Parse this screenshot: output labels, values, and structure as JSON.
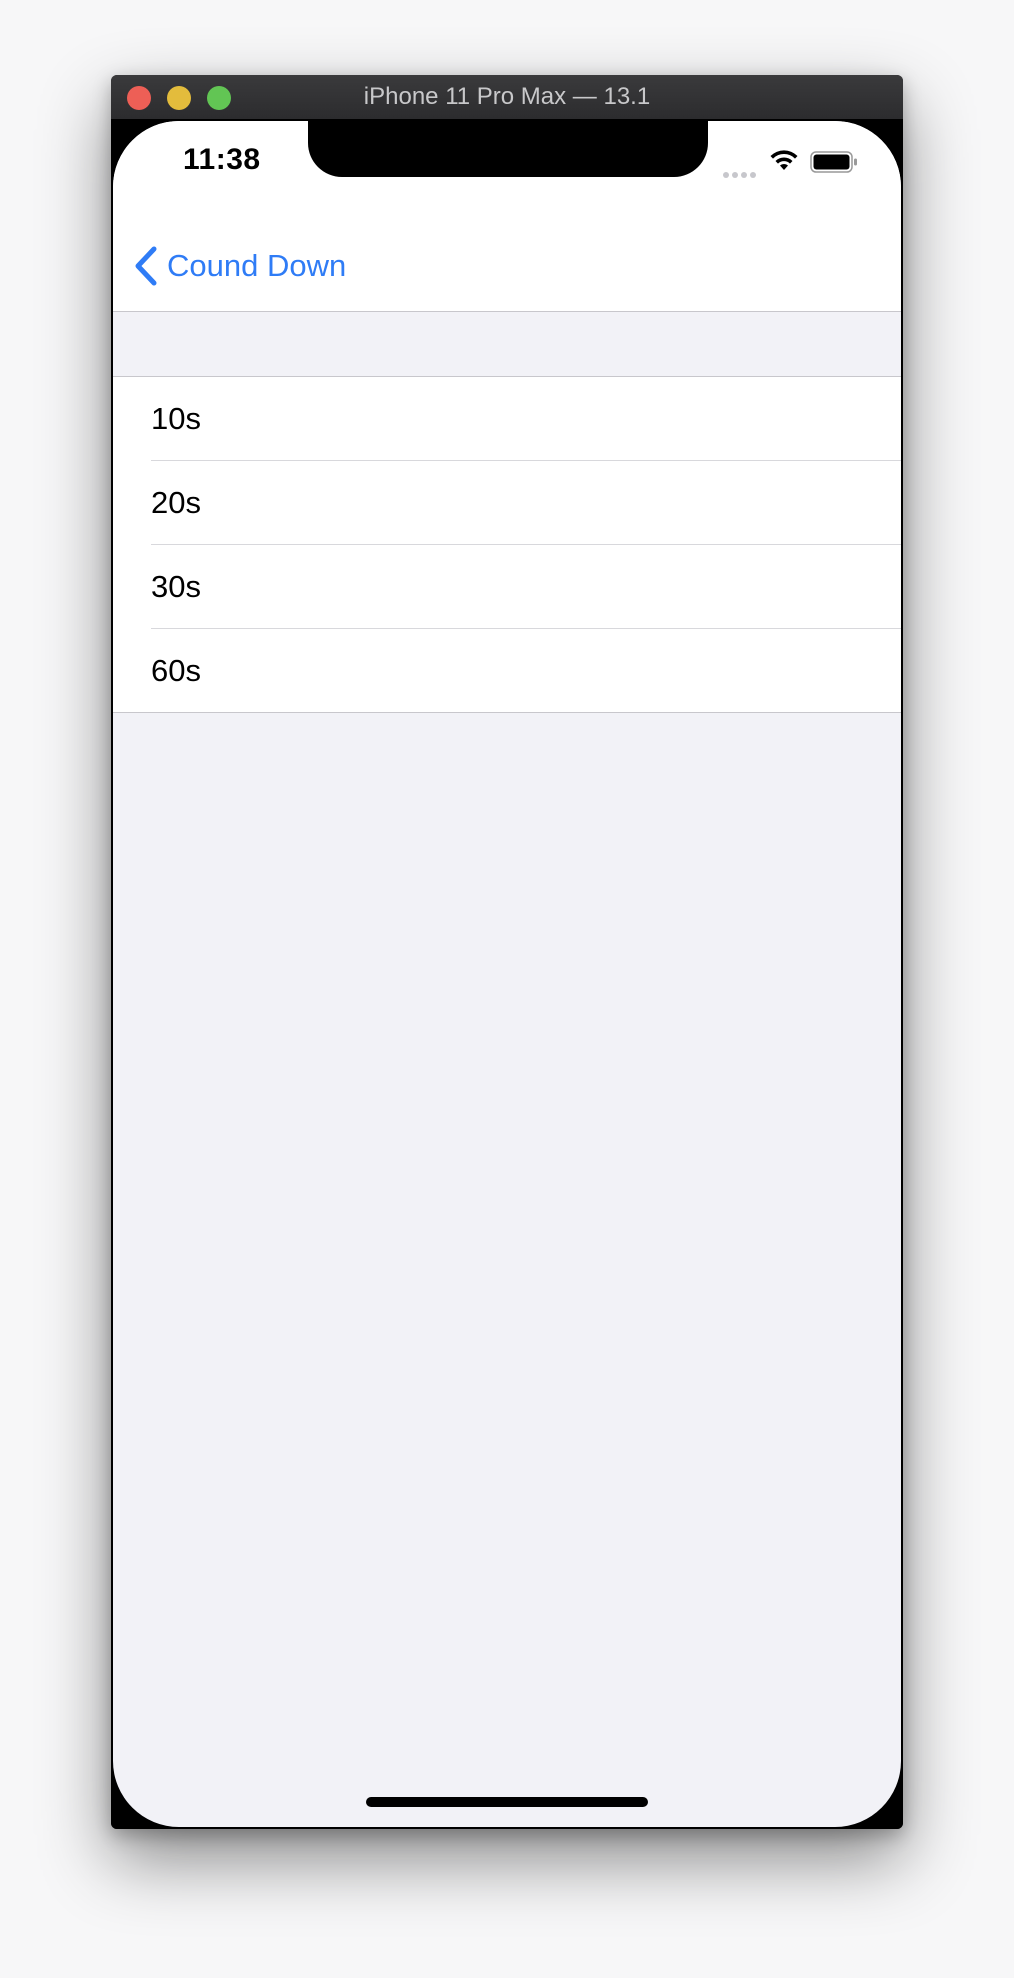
{
  "window": {
    "title": "iPhone 11 Pro Max — 13.1"
  },
  "status_bar": {
    "time": "11:38",
    "icons": [
      "signal-icon",
      "wifi-icon",
      "battery-icon"
    ]
  },
  "nav_bar": {
    "back_label": "Cound Down",
    "back_icon": "chevron-left-icon",
    "accent_color": "#2f7cf6"
  },
  "table": {
    "rows": [
      {
        "label": "10s"
      },
      {
        "label": "20s"
      },
      {
        "label": "30s"
      },
      {
        "label": "60s"
      }
    ]
  },
  "colors": {
    "background": "#f2f2f7",
    "cell_background": "#ffffff",
    "separator": "#c8c7cc",
    "traffic_close": "#ed5f56",
    "traffic_minimize": "#e3bc3c",
    "traffic_zoom": "#62c554"
  }
}
